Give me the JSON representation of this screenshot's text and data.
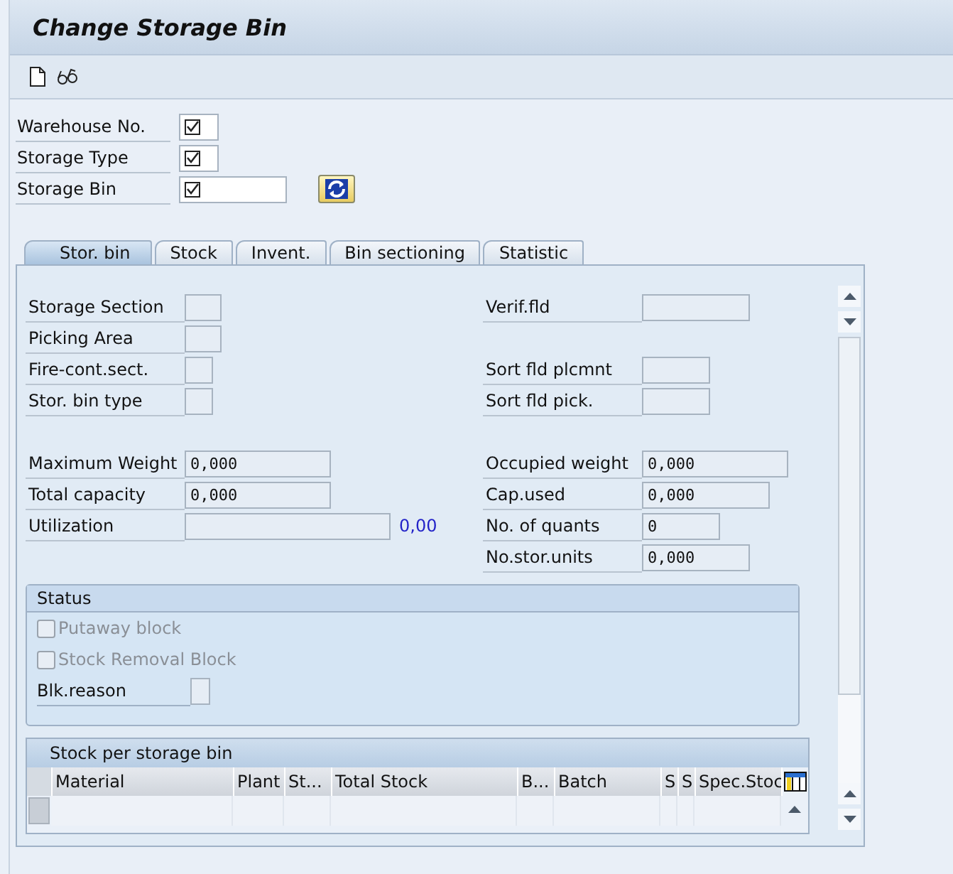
{
  "window": {
    "title": "Change Storage Bin"
  },
  "header_fields": [
    {
      "label": "Warehouse No."
    },
    {
      "label": "Storage Type"
    },
    {
      "label": "Storage Bin"
    }
  ],
  "tabs": [
    {
      "label": "Stor. bin",
      "selected": true
    },
    {
      "label": "Stock",
      "selected": false
    },
    {
      "label": "Invent.",
      "selected": false
    },
    {
      "label": "Bin sectioning",
      "selected": false
    },
    {
      "label": "Statistic",
      "selected": false
    }
  ],
  "left_fields": [
    {
      "label": "Storage Section"
    },
    {
      "label": "Picking Area"
    },
    {
      "label": "Fire-cont.sect."
    },
    {
      "label": "Stor. bin type"
    },
    {
      "label": "Maximum Weight",
      "value": "0,000"
    },
    {
      "label": "Total capacity",
      "value": "0,000"
    },
    {
      "label": "Utilization",
      "reading": "0,00"
    }
  ],
  "right_fields": [
    {
      "label": "Verif.fld"
    },
    {
      "label": "Sort fld plcmnt"
    },
    {
      "label": "Sort fld pick."
    },
    {
      "label": "Occupied weight",
      "value": "0,000"
    },
    {
      "label": "Cap.used",
      "value": "0,000"
    },
    {
      "label": "No. of quants",
      "value": "0"
    },
    {
      "label": "No.stor.units",
      "value": "0,000"
    }
  ],
  "status": {
    "title": "Status",
    "checkboxes": [
      {
        "label": "Putaway block",
        "checked": false,
        "disabled": true
      },
      {
        "label": "Stock Removal Block",
        "checked": false,
        "disabled": true
      }
    ],
    "block_reason": {
      "label": "Blk.reason"
    }
  },
  "table": {
    "title": "Stock per storage bin",
    "columns": [
      "Material",
      "Plant",
      "St...",
      "Total Stock",
      "B...",
      "Batch",
      "S",
      "S",
      "Spec.Stoc"
    ]
  }
}
